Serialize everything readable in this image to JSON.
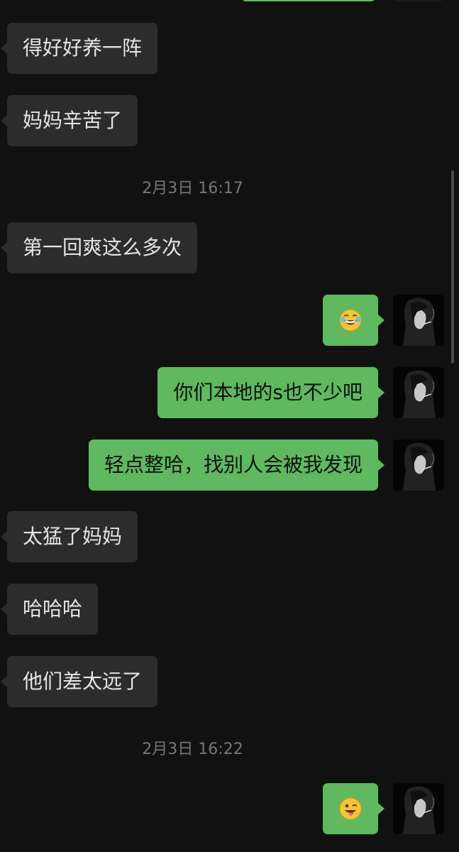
{
  "messages": [
    {
      "side": "left",
      "text": "得好好养一阵"
    },
    {
      "side": "left",
      "text": "妈妈辛苦了"
    },
    {
      "side": "time",
      "text": "2月3日 16:17"
    },
    {
      "side": "left",
      "text": "第一回爽这么多次"
    },
    {
      "side": "right",
      "type": "emoji",
      "emoji": "face-with-tears-of-joy"
    },
    {
      "side": "right",
      "text": "你们本地的s也不少吧"
    },
    {
      "side": "right",
      "text": "轻点整哈，找别人会被我发现"
    },
    {
      "side": "left",
      "text": "太猛了妈妈"
    },
    {
      "side": "left",
      "text": "哈哈哈"
    },
    {
      "side": "left",
      "text": "他们差太远了"
    },
    {
      "side": "time",
      "text": "2月3日 16:22"
    },
    {
      "side": "right",
      "type": "emoji",
      "emoji": "winking-face-with-tongue"
    }
  ],
  "colors": {
    "background": "#111111",
    "incoming_bubble": "#2c2c2c",
    "outgoing_bubble": "#5fb95f",
    "incoming_text": "#e6e6e6",
    "outgoing_text": "#0d0d0d",
    "timestamp": "#777777"
  },
  "icons": {
    "avatar": "avatar-icon",
    "emoji_1": "face-with-tears-of-joy-icon",
    "emoji_2": "winking-face-with-tongue-icon"
  }
}
